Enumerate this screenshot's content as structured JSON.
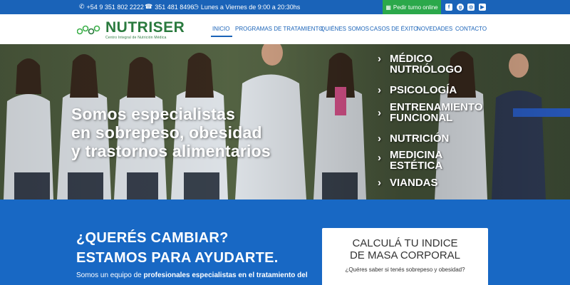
{
  "topbar": {
    "phone1": "+54 9 351 802 2222",
    "phone2": "351 481 8496",
    "hours": "Lunes a Viernes de 9:00 a 20:30hs",
    "turno_label": "Pedir turno online",
    "social": [
      "facebook-icon",
      "google-plus-icon",
      "instagram-icon",
      "youtube-icon"
    ]
  },
  "logo": {
    "name": "NUTRISER",
    "tagline": "Centro Integral de Nutrición Médica"
  },
  "nav": {
    "items": [
      "INICIO",
      "PROGRAMAS DE TRATAMIENTO",
      "QUIÉNES SOMOS",
      "CASOS DE ÉXITO",
      "NOVEDADES",
      "CONTACTO"
    ],
    "active": "INICIO"
  },
  "hero": {
    "title_lines": [
      "Somos especialistas",
      "en sobrepeso, obesidad",
      "y trastornos alimentarios"
    ],
    "services": [
      [
        "MÉDICO",
        "NUTRIÓLOGO"
      ],
      [
        "PSICOLOGÍA"
      ],
      [
        "ENTRENAMIENTO",
        "FUNCIONAL"
      ],
      [
        "NUTRICIÓN"
      ],
      [
        "MEDICINA",
        "ESTÉTICA"
      ],
      [
        "VIANDAS"
      ]
    ]
  },
  "cta": {
    "line1": "¿QUERÉS CAMBIAR?",
    "line2": "ESTAMOS PARA AYUDARTE.",
    "intro_plain": "Somos un equipo de ",
    "intro_bold": "profesionales especialistas en el tratamiento del"
  },
  "bmi": {
    "title1": "CALCULÁ TU INDICE",
    "title2": "DE MASA CORPORAL",
    "question": "¿Quéres saber si tenés sobrepeso y obesidad?"
  },
  "colors": {
    "primary": "#1a63b8",
    "green": "#2ba84a",
    "logo_green": "#2a7a3e",
    "section_bg": "#1868c4"
  }
}
